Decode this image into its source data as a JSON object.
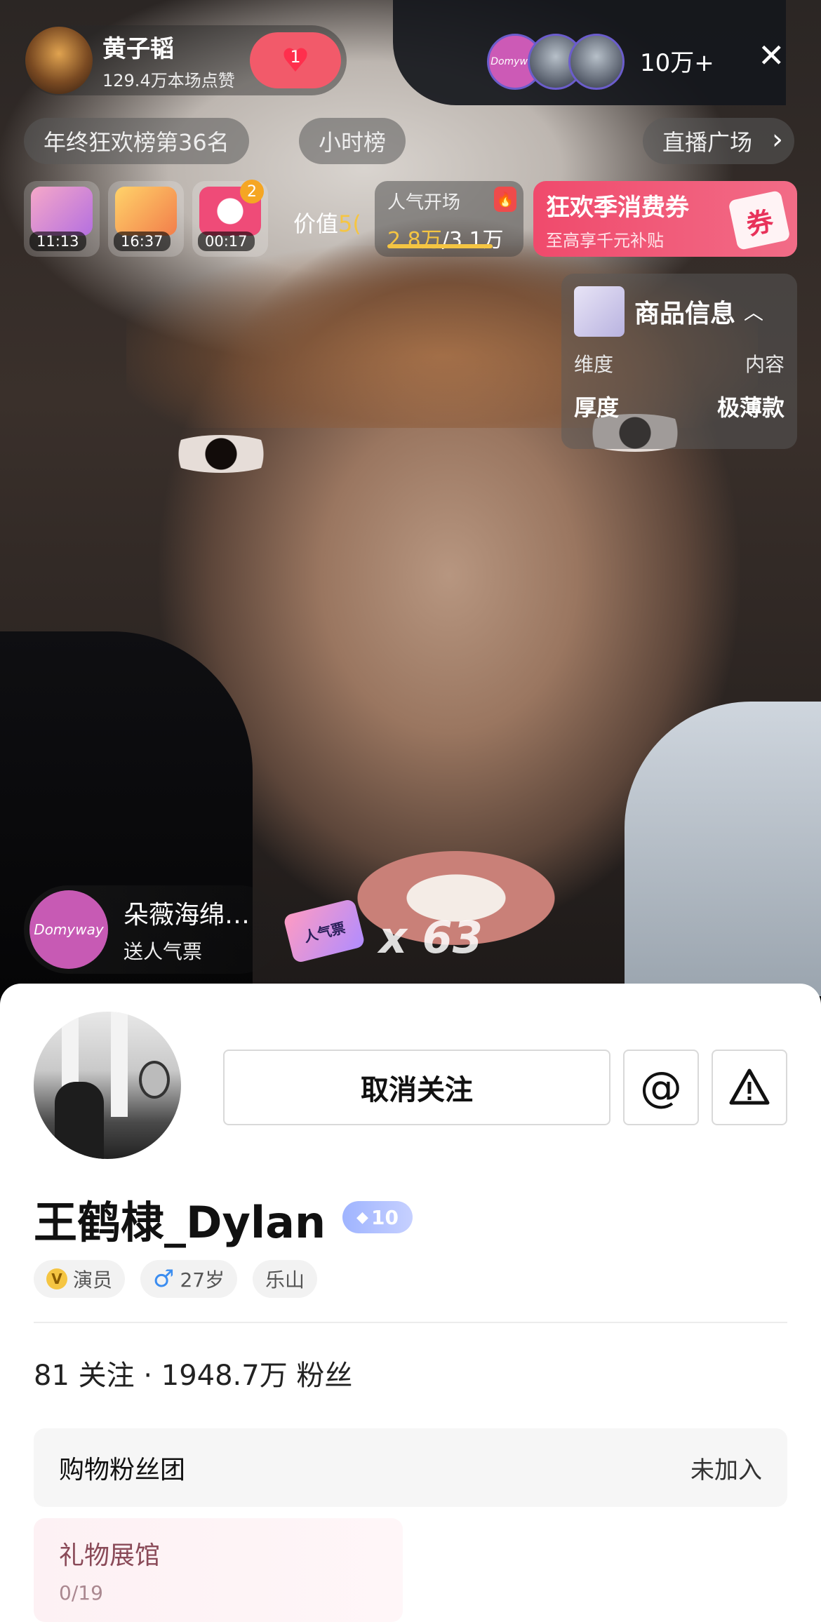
{
  "host": {
    "name": "黄子韬",
    "likes": "129.4万本场点赞",
    "badge_count": "1"
  },
  "viewers": {
    "avatar_label": "Domyway",
    "count": "10万+"
  },
  "rank": {
    "ranking": "年终狂欢榜第36名",
    "hourly": "小时榜",
    "plaza": "直播广场"
  },
  "gifts": [
    {
      "time": "11:13"
    },
    {
      "time": "16:37"
    },
    {
      "time": "00:17",
      "count": "2"
    }
  ],
  "value_label": "价值",
  "value_amount": "5(",
  "popularity": {
    "label": "人气开场",
    "current": "2.8万",
    "target": "/3.1万"
  },
  "coupon": {
    "title": "狂欢季消费券",
    "subtitle": "至高享千元补贴",
    "tag": "券"
  },
  "product": {
    "title": "商品信息",
    "rows": [
      {
        "key": "维度",
        "value": "内容"
      },
      {
        "key": "厚度",
        "value": "极薄款"
      }
    ]
  },
  "gift_feed": {
    "name": "朵薇海绵…",
    "action": "送人气票",
    "avatar_label": "Domyway",
    "ticket": "人气票",
    "combo": "x 63"
  },
  "profile": {
    "unfollow_label": "取消关注",
    "at_label": "@",
    "name": "王鹤棣_Dylan",
    "level": "10",
    "tags": {
      "role": "演员",
      "age": "27岁",
      "city": "乐山"
    },
    "stats": "81 关注 · 1948.7万 粉丝",
    "fan_club": {
      "label": "购物粉丝团",
      "status": "未加入"
    },
    "gift_hall": {
      "title": "礼物展馆",
      "count": "0/19"
    }
  }
}
